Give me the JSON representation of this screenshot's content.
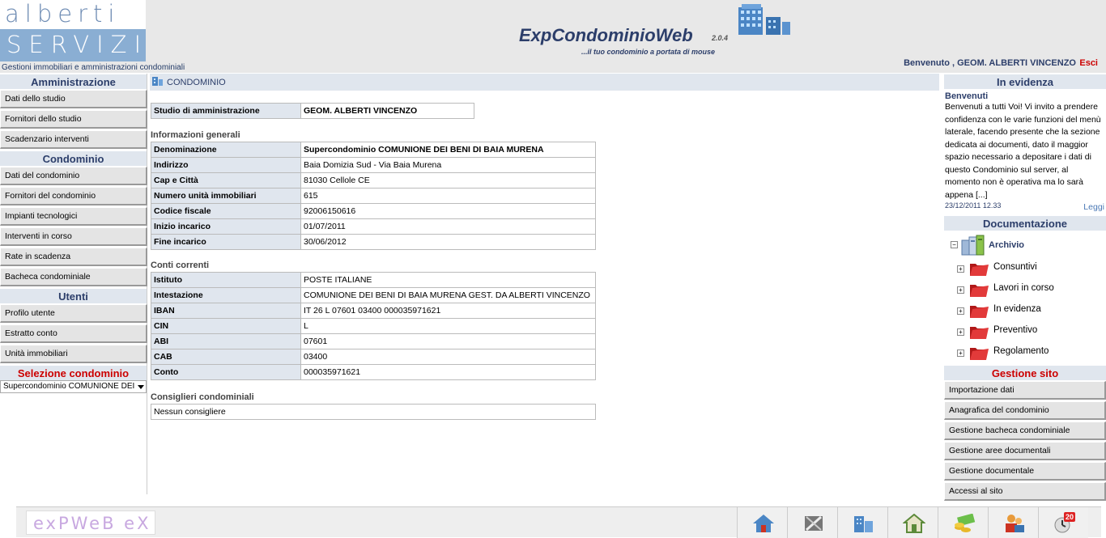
{
  "header": {
    "logo_top": "alberti",
    "logo_bottom": "SERVIZI",
    "tagline": "Gestioni immobiliari e amministrazioni condominiali",
    "app_title": "ExpCondominioWeb",
    "app_version": "2.0.4",
    "app_subtitle": "...il tuo condominio a portata di mouse",
    "welcome": "Benvenuto , GEOM. ALBERTI VINCENZO",
    "logout": "Esci"
  },
  "sidebar": {
    "amministrazione": {
      "title": "Amministrazione",
      "items": [
        "Dati dello studio",
        "Fornitori dello studio",
        "Scadenzario interventi"
      ]
    },
    "condominio": {
      "title": "Condominio",
      "items": [
        "Dati del condominio",
        "Fornitori del condominio",
        "Impianti tecnologici",
        "Interventi in corso",
        "Rate in scadenza",
        "Bacheca condominiale"
      ]
    },
    "utenti": {
      "title": "Utenti",
      "items": [
        "Profilo utente",
        "Estratto conto",
        "Unità immobiliari"
      ]
    },
    "selezione": {
      "title": "Selezione condominio",
      "selected": "Supercondominio COMUNIONE DEI BENI DI BAIA MURENA"
    }
  },
  "main": {
    "section_title": "CONDOMINIO",
    "studio": {
      "label": "Studio di amministrazione",
      "value": "GEOM. ALBERTI VINCENZO"
    },
    "info_title": "Informazioni generali",
    "info": [
      {
        "label": "Denominazione",
        "value": "Supercondominio COMUNIONE DEI BENI DI BAIA MURENA"
      },
      {
        "label": "Indirizzo",
        "value": "Baia Domizia Sud - Via Baia Murena"
      },
      {
        "label": "Cap e Città",
        "value": "81030 Cellole CE"
      },
      {
        "label": "Numero unità immobiliari",
        "value": "615"
      },
      {
        "label": "Codice fiscale",
        "value": "92006150616"
      },
      {
        "label": "Inizio incarico",
        "value": "01/07/2011"
      },
      {
        "label": "Fine incarico",
        "value": "30/06/2012"
      }
    ],
    "conti_title": "Conti correnti",
    "conti": [
      {
        "label": "Istituto",
        "value": "POSTE ITALIANE"
      },
      {
        "label": "Intestazione",
        "value": "COMUNIONE DEI BENI DI BAIA MURENA GEST. DA ALBERTI VINCENZO"
      },
      {
        "label": "IBAN",
        "value": "IT 26 L 07601 03400 000035971621"
      },
      {
        "label": "CIN",
        "value": "L"
      },
      {
        "label": "ABI",
        "value": "07601"
      },
      {
        "label": "CAB",
        "value": "03400"
      },
      {
        "label": "Conto",
        "value": "000035971621"
      }
    ],
    "consiglieri_title": "Consiglieri condominiali",
    "consiglieri_value": "Nessun consigliere"
  },
  "right": {
    "evidenza_title": "In evidenza",
    "news_title": "Benvenuti",
    "news_body": "Benvenuti a tutti Voi! Vi invito a prendere confidenza con le varie funzioni del menù laterale, facendo presente che la sezione dedicata ai documenti, dato il maggior spazio necessario a depositare i dati di questo Condominio sul server, al momento non è operativa ma lo sarà appena [...]",
    "news_date": "23/12/2011 12.33",
    "news_more": "Leggi",
    "doc_title": "Documentazione",
    "archive_label": "Archivio",
    "folders": [
      "Consuntivi",
      "Lavori in corso",
      "In evidenza",
      "Preventivo",
      "Regolamento"
    ],
    "gestione_title": "Gestione sito",
    "gestione_items": [
      "Importazione dati",
      "Anagrafica del condominio",
      "Gestione bacheca condominiale",
      "Gestione aree documentali",
      "Gestione documentale",
      "Accessi al sito"
    ]
  },
  "footer": {
    "logo": "exPWeB eX",
    "badge_count": "20",
    "buttons": [
      "home-icon",
      "tools-icon",
      "buildings-icon",
      "house-icon",
      "money-icon",
      "users-icon",
      "calendar-icon"
    ]
  },
  "colors": {
    "accent": "#2c3e6a",
    "header_bg": "#e8e8e8",
    "section_bg": "#e0e6ee",
    "alert": "#cc0000"
  }
}
